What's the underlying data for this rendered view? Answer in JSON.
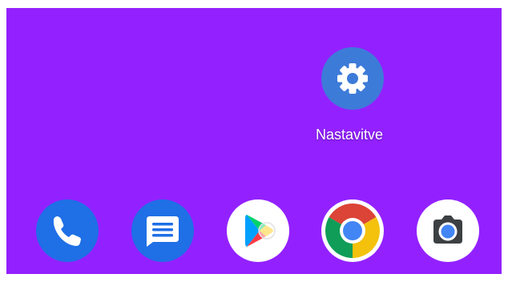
{
  "home_screen": {
    "background": "#9321ff",
    "settings_app": {
      "label": "Nastavitve",
      "icon": "gear-icon",
      "color": "#3d7bd9"
    }
  },
  "dock": {
    "apps": [
      {
        "name": "phone",
        "icon": "phone-icon",
        "color": "#1f6fe6"
      },
      {
        "name": "messages",
        "icon": "message-icon",
        "color": "#1f6fe6"
      },
      {
        "name": "play-store",
        "icon": "play-store-icon",
        "color": "#ffffff"
      },
      {
        "name": "chrome",
        "icon": "chrome-icon",
        "color": "#ffffff"
      },
      {
        "name": "camera",
        "icon": "camera-icon",
        "color": "#ffffff"
      }
    ]
  }
}
